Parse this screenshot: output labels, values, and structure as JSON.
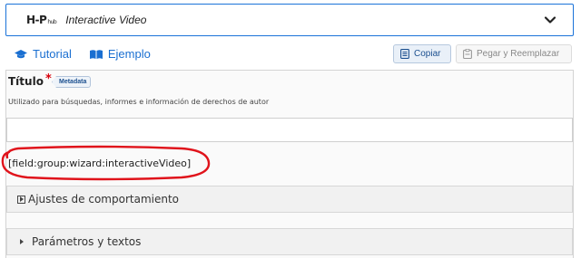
{
  "hub": {
    "logo_text": "H-P",
    "logo_sub": "hub",
    "content_type": "Interactive Video"
  },
  "links": {
    "tutorial": "Tutorial",
    "example": "Ejemplo"
  },
  "buttons": {
    "copy": "Copiar",
    "paste_replace": "Pegar y Reemplazar"
  },
  "form": {
    "title_label": "Título",
    "required_mark": "*",
    "metadata_tag": "Metadata",
    "title_description": "Utilizado para búsquedas, informes e información de derechos de autor",
    "title_value": "",
    "field_placeholder_text": "[field:group:wizard:interactiveVideo]"
  },
  "sections": [
    {
      "label": "Ajustes de comportamiento"
    },
    {
      "label": "Parámetros y textos"
    }
  ],
  "colors": {
    "accent": "#1a6fd1",
    "required": "#d8000c",
    "annotation": "#e0131b"
  }
}
